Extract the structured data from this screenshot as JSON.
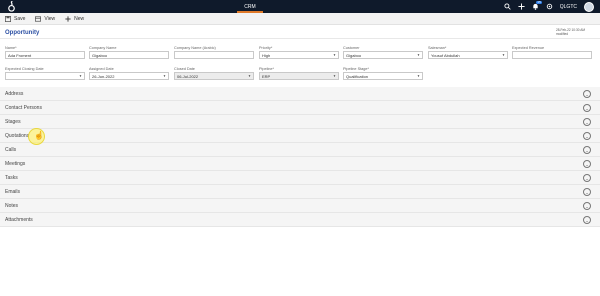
{
  "topbar": {
    "app_name": "CRM",
    "org_label": "QLGTC",
    "notif_count": "15",
    "icons": [
      "search-icon",
      "plus-icon",
      "bell-icon",
      "settings-icon"
    ],
    "accent_color": "#e07a2a",
    "bg_color": "#0f1a2b"
  },
  "toolbar": {
    "save_label": "Save",
    "view_label": "View",
    "new_label": "New"
  },
  "page": {
    "title": "Opportunity",
    "timestamp_line1": "28-Feb-22 10:30 AM",
    "timestamp_line2": "modified",
    "title_color": "#2b4fa3"
  },
  "form": {
    "name": {
      "label": "Name*",
      "value": "Ada Froment"
    },
    "company_name": {
      "label": "Company Name",
      "value": "Gigaboo"
    },
    "company_name_arabic": {
      "label": "Company Name (Arabic)",
      "value": ""
    },
    "priority": {
      "label": "Priority*",
      "value": "High"
    },
    "customer": {
      "label": "Customer",
      "value": "Gigaboo"
    },
    "salesman": {
      "label": "Salesman*",
      "value": "Yousuf Abdullah"
    },
    "expected_revenue": {
      "label": "Expected Revenue",
      "value": ""
    },
    "expected_closing_date": {
      "label": "Expected Closing Date",
      "value": ""
    },
    "assigned_date": {
      "label": "Assigned Date",
      "value": "26-Jun-2022"
    },
    "closed_date": {
      "label": "Closed Date",
      "value": "06-Jul-2022"
    },
    "pipeline": {
      "label": "Pipeline*",
      "value": "ERP"
    },
    "pipeline_stage": {
      "label": "Pipeline Stage*",
      "value": "Qualification"
    }
  },
  "sections": [
    {
      "label": "Address"
    },
    {
      "label": "Contact Persons"
    },
    {
      "label": "Stages"
    },
    {
      "label": "Quotations"
    },
    {
      "label": "Calls"
    },
    {
      "label": "Meetings"
    },
    {
      "label": "Tasks"
    },
    {
      "label": "Emails"
    },
    {
      "label": "Notes"
    },
    {
      "label": "Attachments"
    }
  ]
}
